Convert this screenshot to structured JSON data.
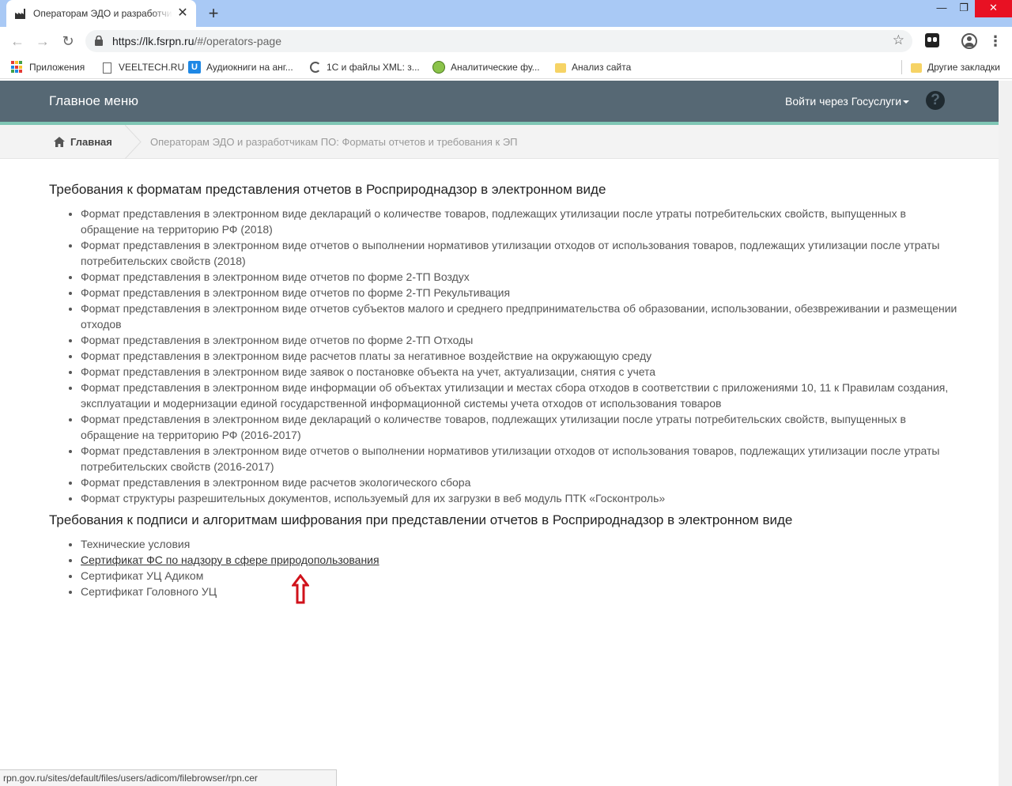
{
  "browser": {
    "tab_title": "Операторам ЭДО и разработчикам ПО",
    "url_host": "https://lk.fsrpn.ru",
    "url_path": "/#/operators-page",
    "bookmarks": [
      {
        "label": "Приложения",
        "icon": "apps-grid-icon"
      },
      {
        "label": "VEELTECH.RU",
        "icon": "page-icon"
      },
      {
        "label": "Аудиокниги на анг...",
        "icon": "u-icon"
      },
      {
        "label": "1С и файлы XML: з...",
        "icon": "c-icon"
      },
      {
        "label": "Аналитические фу...",
        "icon": "tree-icon"
      },
      {
        "label": "Анализ сайта",
        "icon": "folder-icon"
      }
    ],
    "other_bookmarks": "Другие закладки",
    "status_url": "rpn.gov.ru/sites/default/files/users/adicom/filebrowser/rpn.cer"
  },
  "header": {
    "main_menu": "Главное меню",
    "login": "Войти через Госуслуги"
  },
  "breadcrumb": {
    "home": "Главная",
    "current": "Операторам ЭДО и разработчикам ПО: Форматы отчетов и требования к ЭП"
  },
  "section1": {
    "title": "Требования к форматам представления отчетов в Росприроднадзор в электронном виде",
    "items": [
      "Формат представления в электронном виде деклараций о количестве товаров, подлежащих утилизации после утраты потребительских свойств, выпущенных в обращение на территорию РФ (2018)",
      "Формат представления в электронном виде отчетов о выполнении нормативов утилизации отходов от использования товаров, подлежащих утилизации после утраты потребительских свойств (2018)",
      "Формат представления в электронном виде отчетов по форме 2-ТП Воздух",
      "Формат представления в электронном виде отчетов по форме 2-ТП Рекультивация",
      "Формат представления в электронном виде отчетов субъектов малого и среднего предпринимательства об образовании, использовании, обезвреживании и размещении отходов",
      "Формат представления в электронном виде отчетов по форме 2-ТП Отходы",
      "Формат представления в электронном виде расчетов платы за негативное воздействие на окружающую среду",
      "Формат представления в электронном виде заявок о постановке объекта на учет, актуализации, снятия с учета",
      "Формат представления в электронном виде информации об объектах утилизации и местах сбора отходов в соответствии с приложениями 10, 11 к Правилам создания, эксплуатации и модернизации единой государственной информационной системы учета отходов от использования товаров",
      "Формат представления в электронном виде деклараций о количестве товаров, подлежащих утилизации после утраты потребительских свойств, выпущенных в обращение на территорию РФ (2016-2017)",
      "Формат представления в электронном виде отчетов о выполнении нормативов утилизации отходов от использования товаров, подлежащих утилизации после утраты потребительских свойств (2016-2017)",
      "Формат представления в электронном виде расчетов экологического сбора",
      "Формат структуры разрешительных документов, используемый для их загрузки в веб модуль ПТК «Госконтроль»"
    ]
  },
  "section2": {
    "title": "Требования к подписи и алгоритмам шифрования при представлении отчетов в Росприроднадзор в электронном виде",
    "items": [
      "Технические условия",
      "Сертификат ФС по надзору в сфере природопользования",
      "Сертификат УЦ Адиком",
      "Сертификат Головного УЦ"
    ]
  },
  "colors": {
    "header_bg": "#566874",
    "header_accent": "#7fc6b5",
    "arrow": "#d0121b"
  }
}
